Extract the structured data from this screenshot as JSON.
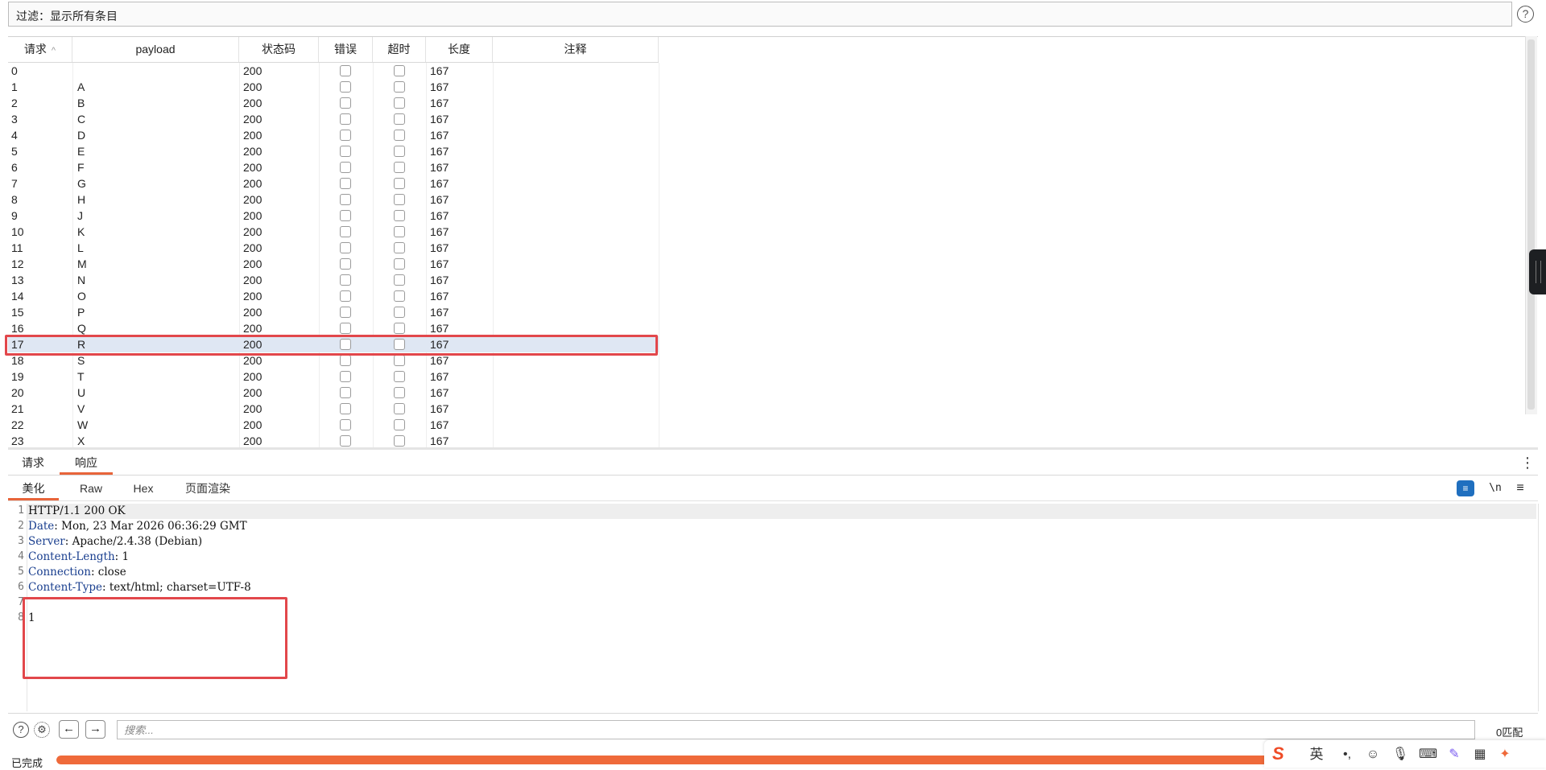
{
  "filter": {
    "text": "过滤：显示所有条目",
    "help_icon": "help-icon"
  },
  "table": {
    "columns": [
      "请求",
      "payload",
      "状态码",
      "错误",
      "超时",
      "长度",
      "注释"
    ],
    "sort_indicator": "^",
    "selected_index": 17,
    "rows": [
      {
        "req": "0",
        "payload": "",
        "status": "200",
        "length": "167"
      },
      {
        "req": "1",
        "payload": "A",
        "status": "200",
        "length": "167"
      },
      {
        "req": "2",
        "payload": "B",
        "status": "200",
        "length": "167"
      },
      {
        "req": "3",
        "payload": "C",
        "status": "200",
        "length": "167"
      },
      {
        "req": "4",
        "payload": "D",
        "status": "200",
        "length": "167"
      },
      {
        "req": "5",
        "payload": "E",
        "status": "200",
        "length": "167"
      },
      {
        "req": "6",
        "payload": "F",
        "status": "200",
        "length": "167"
      },
      {
        "req": "7",
        "payload": "G",
        "status": "200",
        "length": "167"
      },
      {
        "req": "8",
        "payload": "H",
        "status": "200",
        "length": "167"
      },
      {
        "req": "9",
        "payload": "J",
        "status": "200",
        "length": "167"
      },
      {
        "req": "10",
        "payload": "K",
        "status": "200",
        "length": "167"
      },
      {
        "req": "11",
        "payload": "L",
        "status": "200",
        "length": "167"
      },
      {
        "req": "12",
        "payload": "M",
        "status": "200",
        "length": "167"
      },
      {
        "req": "13",
        "payload": "N",
        "status": "200",
        "length": "167"
      },
      {
        "req": "14",
        "payload": "O",
        "status": "200",
        "length": "167"
      },
      {
        "req": "15",
        "payload": "P",
        "status": "200",
        "length": "167"
      },
      {
        "req": "16",
        "payload": "Q",
        "status": "200",
        "length": "167"
      },
      {
        "req": "17",
        "payload": "R",
        "status": "200",
        "length": "167"
      },
      {
        "req": "18",
        "payload": "S",
        "status": "200",
        "length": "167"
      },
      {
        "req": "19",
        "payload": "T",
        "status": "200",
        "length": "167"
      },
      {
        "req": "20",
        "payload": "U",
        "status": "200",
        "length": "167"
      },
      {
        "req": "21",
        "payload": "V",
        "status": "200",
        "length": "167"
      },
      {
        "req": "22",
        "payload": "W",
        "status": "200",
        "length": "167"
      },
      {
        "req": "23",
        "payload": "X",
        "status": "200",
        "length": "167"
      }
    ]
  },
  "tabs": {
    "request": "请求",
    "response": "响应",
    "active": "响应"
  },
  "subtabs": {
    "pretty": "美化",
    "raw": "Raw",
    "hex": "Hex",
    "render": "页面渲染",
    "active": "美化"
  },
  "toolbar": {
    "wrap_icon": "wrap-lines-icon",
    "newline_label": "\\n",
    "menu_icon": "hamburger-menu-icon"
  },
  "response_lines": [
    {
      "n": "1",
      "key": "",
      "text": "HTTP/1.1 200 OK"
    },
    {
      "n": "2",
      "key": "Date",
      "text": ": Mon, 23 Mar 2026 06:36:29 GMT"
    },
    {
      "n": "3",
      "key": "Server",
      "text": ": Apache/2.4.38 (Debian)"
    },
    {
      "n": "4",
      "key": "Content-Length",
      "text": ": 1"
    },
    {
      "n": "5",
      "key": "Connection",
      "text": ": close"
    },
    {
      "n": "6",
      "key": "Content-Type",
      "text": ": text/html; charset=UTF-8"
    },
    {
      "n": "7",
      "key": "",
      "text": ""
    },
    {
      "n": "8",
      "key": "",
      "text": "1"
    }
  ],
  "search": {
    "placeholder": "搜索...",
    "value": "",
    "match_count": "0匹配"
  },
  "status": {
    "text": "已完成",
    "progress": 1.0
  },
  "ime": {
    "mode_label": "英"
  },
  "colors": {
    "accent": "#e8643a",
    "highlight_box": "#e2474b",
    "selected_row": "#dfe7f3",
    "progress": "#ef6a3a",
    "wrap_btn": "#1f6fbf"
  }
}
